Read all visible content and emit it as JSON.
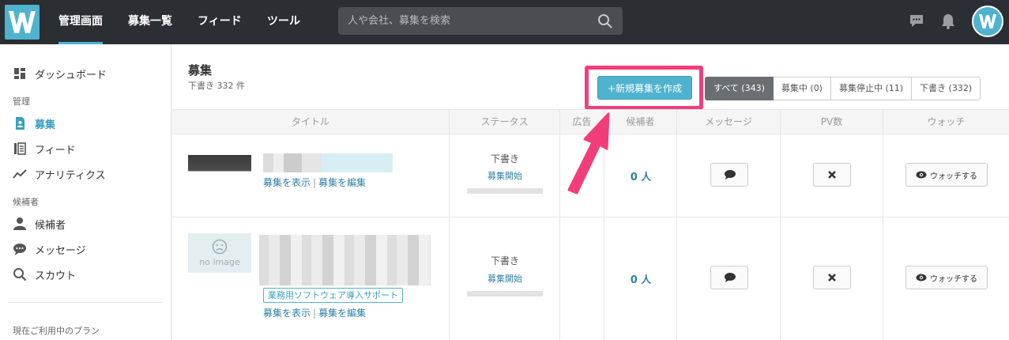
{
  "topbar": {
    "logo_letter": "W",
    "nav": [
      {
        "label": "管理画面",
        "active": true
      },
      {
        "label": "募集一覧",
        "active": false
      },
      {
        "label": "フィード",
        "active": false
      },
      {
        "label": "ツール",
        "active": false
      }
    ],
    "search_placeholder": "人や会社、募集を検索"
  },
  "sidebar": {
    "dashboard": "ダッシュボード",
    "section_manage": "管理",
    "recruit": "募集",
    "feed": "フィード",
    "analytics": "アナリティクス",
    "section_candidates": "候補者",
    "candidates": "候補者",
    "messages": "メッセージ",
    "scout": "スカウト",
    "section_plan": "現在ご利用中のプラン"
  },
  "main": {
    "title": "募集",
    "subtitle": "下書き 332 件",
    "create_button": "+新規募集を作成",
    "filters": [
      {
        "label": "すべて (343)",
        "active": true
      },
      {
        "label": "募集中 (0)",
        "active": false
      },
      {
        "label": "募集停止中 (11)",
        "active": false
      },
      {
        "label": "下書き (332)",
        "active": false
      }
    ],
    "columns": {
      "title": "タイトル",
      "status": "ステータス",
      "ad": "広告",
      "candidates": "候補者",
      "message": "メッセージ",
      "pv": "PV数",
      "watch": "ウォッチ"
    },
    "rows": [
      {
        "status": "下書き",
        "status_link": "募集開始",
        "view_link": "募集を表示",
        "separator": "|",
        "edit_link": "募集を編集",
        "candidates": "0 人",
        "watch_label": "ウォッチする"
      },
      {
        "thumb_label": "no image",
        "tag": "業務用ソフトウェア導入サポート",
        "status": "下書き",
        "status_link": "募集開始",
        "view_link": "募集を表示",
        "separator": "|",
        "edit_link": "募集を編集",
        "candidates": "0 人",
        "watch_label": "ウォッチする"
      }
    ]
  },
  "colors": {
    "accent": "#4fb3cf",
    "highlight": "#f23d7b",
    "topbar": "#2b2e33"
  }
}
